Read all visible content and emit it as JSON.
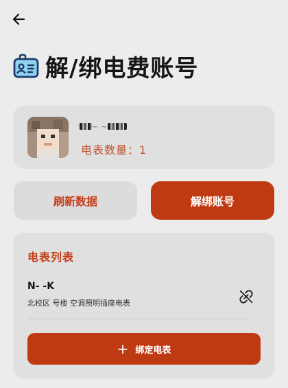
{
  "header": {
    "title": "解/绑电费账号",
    "back_icon": "arrow-left-icon",
    "title_icon": "id-card-icon"
  },
  "account": {
    "name": "~ ~",
    "meter_count_label": "电表数量：1"
  },
  "actions": {
    "refresh_label": "刷新数据",
    "unbind_label": "解绑账号"
  },
  "meter_list": {
    "title": "电表列表",
    "items": [
      {
        "id": "N-  -K",
        "description": "北校区  号楼    空调照明插座电表",
        "action_icon": "unlink-icon"
      }
    ],
    "bind_label": "绑定电表"
  },
  "colors": {
    "accent": "#bf3a12",
    "accent_text": "#c43f1a",
    "card_bg": "#e0e0e0",
    "page_bg": "#ececec"
  }
}
